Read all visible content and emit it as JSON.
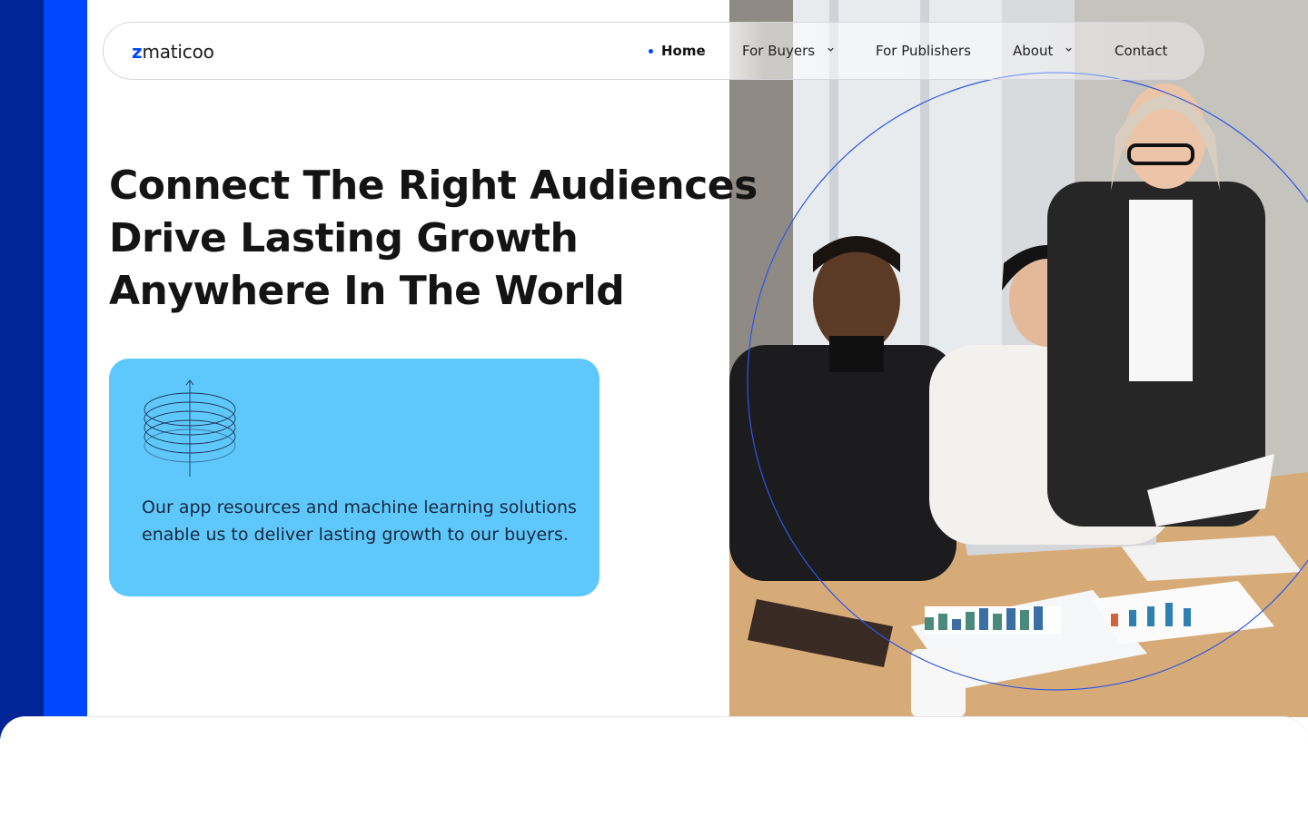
{
  "brand": {
    "logo_text_prefix": "z",
    "logo_text_rest": "maticoo",
    "accent_color": "#0048ff",
    "dark_stripe_color": "#012496",
    "card_color": "#5ec8fd"
  },
  "nav": {
    "items": [
      {
        "label": "Home",
        "active": true
      },
      {
        "label": "For Buyers",
        "dropdown": true
      },
      {
        "label": "For Publishers"
      },
      {
        "label": "About",
        "dropdown": true
      },
      {
        "label": "Contact"
      }
    ]
  },
  "hero": {
    "title_lines": [
      "Connect The Right Audiences",
      "Drive Lasting Growth",
      "Anywhere In The World"
    ]
  },
  "card": {
    "icon": "stacked-rings-icon",
    "text": "Our app resources and machine learning solutions enable us to deliver lasting growth to our buyers."
  },
  "photo": {
    "subject": "team-meeting-photo"
  }
}
